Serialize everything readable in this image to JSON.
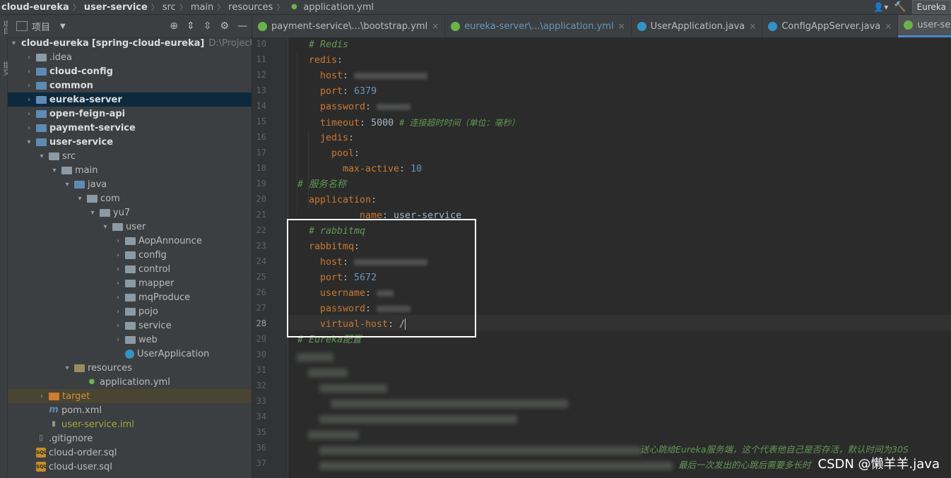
{
  "breadcrumb": [
    "cloud-eureka",
    "user-service",
    "src",
    "main",
    "resources",
    "application.yml"
  ],
  "toolbar_right": {
    "user_icon": "user-icon",
    "build_icon": "hammer-icon",
    "run_config": "Eureka"
  },
  "left_strip": {
    "label_top": "项目",
    "label_mid": "提交"
  },
  "project_panel": {
    "title": "项目",
    "root": {
      "name": "cloud-eureka",
      "module": "[spring-cloud-eureka]",
      "path": "D:\\Project\\clo"
    },
    "items": [
      {
        "label": ".idea"
      },
      {
        "label": "cloud-config"
      },
      {
        "label": "common"
      },
      {
        "label": "eureka-server"
      },
      {
        "label": "open-feign-api"
      },
      {
        "label": "payment-service"
      },
      {
        "label": "user-service"
      },
      {
        "label": "src"
      },
      {
        "label": "main"
      },
      {
        "label": "java"
      },
      {
        "label": "com"
      },
      {
        "label": "yu7"
      },
      {
        "label": "user"
      },
      {
        "label": "AopAnnounce"
      },
      {
        "label": "config"
      },
      {
        "label": "control"
      },
      {
        "label": "mapper"
      },
      {
        "label": "mqProduce"
      },
      {
        "label": "pojo"
      },
      {
        "label": "service"
      },
      {
        "label": "web"
      },
      {
        "label": "UserApplication"
      },
      {
        "label": "resources"
      },
      {
        "label": "application.yml"
      },
      {
        "label": "target"
      },
      {
        "label": "pom.xml"
      },
      {
        "label": "user-service.iml"
      },
      {
        "label": ".gitignore"
      },
      {
        "label": "cloud-order.sql"
      },
      {
        "label": "cloud-user.sql"
      }
    ]
  },
  "tabs": [
    {
      "label": "payment-service\\...\\bootstrap.yml"
    },
    {
      "label": "eureka-server\\...\\application.yml"
    },
    {
      "label": "UserApplication.java"
    },
    {
      "label": "ConfigAppServer.java"
    },
    {
      "label": "user-service\\...\\applica"
    }
  ],
  "code": {
    "line_numbers": [
      "10",
      "11",
      "12",
      "13",
      "14",
      "15",
      "16",
      "17",
      "18",
      "19",
      "20",
      "21",
      "22",
      "23",
      "24",
      "25",
      "26",
      "27",
      "28",
      "29",
      "30",
      "31",
      "32",
      "33",
      "34",
      "35",
      "36",
      "37"
    ],
    "l10": "# Redis",
    "l11_key": "redis",
    "l12_key": "host",
    "l13_key": "port",
    "l13_val": "6379",
    "l14_key": "password",
    "l15_key": "timeout",
    "l15_val": "5000",
    "l15_comment": "# 连接超时时间（单位：毫秒）",
    "l16_key": "jedis",
    "l17_key": "pool",
    "l18_key": "max-active",
    "l18_val": "10",
    "l19": "# 服务名称",
    "l20_key": "application",
    "l21_key": "name",
    "l21_val": "user-service",
    "l22": "# rabbitmq",
    "l23_key": "rabbitmq",
    "l24_key": "host",
    "l25_key": "port",
    "l25_val": "5672",
    "l26_key": "username",
    "l27_key": "password",
    "l28_key": "virtual-host",
    "l28_val": "/",
    "l29": "# Eureka配置",
    "l36_comment": "送心跳给Eureka服务端，这个代表他自己是否存活，默认时间为30S",
    "l37_comment": "最后一次发出的心跳后需要多长时"
  },
  "watermark": "CSDN @懒羊羊.java"
}
